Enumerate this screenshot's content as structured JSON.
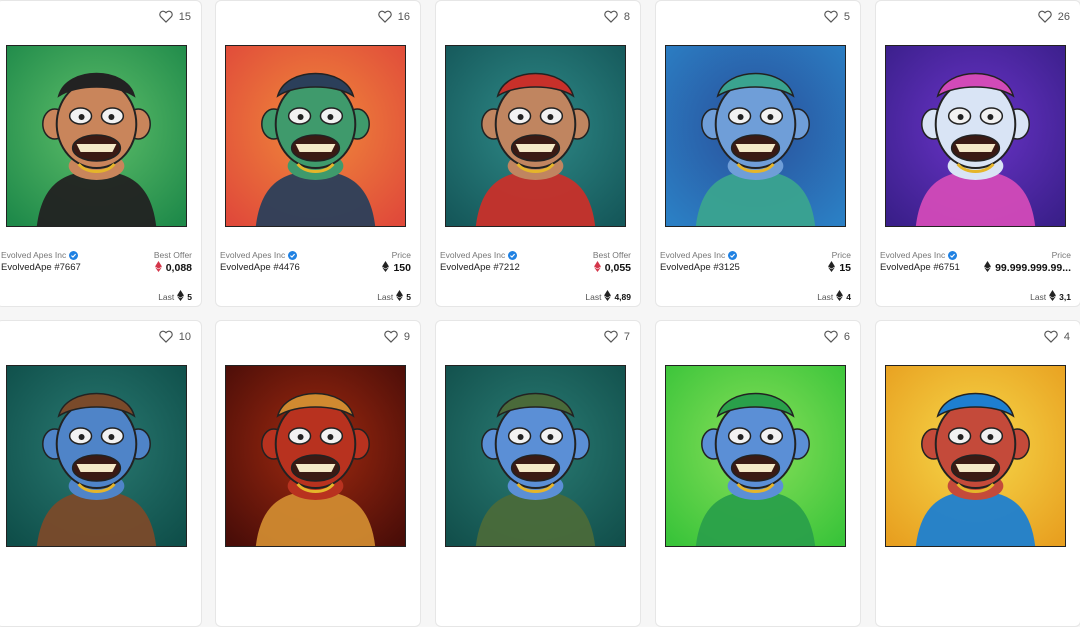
{
  "colors": {
    "verified": "#2081e2",
    "eth_offer": "#d4364a",
    "eth_price": "#222222"
  },
  "icons": {
    "like": "heart-outline-icon",
    "verified": "verified-check-icon",
    "currency": "ethereum-icon"
  },
  "cards": [
    {
      "likes": "15",
      "collection": "Evolved Apes Inc",
      "token": "EvolvedApe #7667",
      "price_label": "Best Offer",
      "price": "0,088",
      "price_currency": "weth",
      "last_label": "Last",
      "last_price": "5",
      "bg": [
        "#1f8a4a",
        "#5fbf6a"
      ],
      "skin": "#c9855b",
      "accent": "#222222"
    },
    {
      "likes": "16",
      "collection": "Evolved Apes Inc",
      "token": "EvolvedApe #4476",
      "price_label": "Price",
      "price": "150",
      "price_currency": "eth",
      "last_label": "Last",
      "last_price": "5",
      "bg": [
        "#e04a3a",
        "#f08a3a"
      ],
      "skin": "#3f9a6c",
      "accent": "#2b3f5a"
    },
    {
      "likes": "8",
      "collection": "Evolved Apes Inc",
      "token": "EvolvedApe #7212",
      "price_label": "Best Offer",
      "price": "0,055",
      "price_currency": "weth",
      "last_label": "Last",
      "last_price": "4,89",
      "bg": [
        "#15585a",
        "#2f8a88"
      ],
      "skin": "#c08560",
      "accent": "#c8302a"
    },
    {
      "likes": "5",
      "collection": "Evolved Apes Inc",
      "token": "EvolvedApe #3125",
      "price_label": "Price",
      "price": "15",
      "price_currency": "eth",
      "last_label": "Last",
      "last_price": "4",
      "bg": [
        "#2b7fc4",
        "#2a4f9a"
      ],
      "skin": "#6f9ed8",
      "accent": "#3aa38f"
    },
    {
      "likes": "26",
      "collection": "Evolved Apes Inc",
      "token": "EvolvedApe #6751",
      "price_label": "Price",
      "price": "99.999.999.99...",
      "price_currency": "eth",
      "last_label": "Last",
      "last_price": "3,1",
      "bg": [
        "#3a1f8a",
        "#6a34c8"
      ],
      "skin": "#d9e4f5",
      "accent": "#d24ab8"
    },
    {
      "likes": "10",
      "collection": "",
      "token": "",
      "price_label": "",
      "price": "",
      "price_currency": "",
      "last_label": "",
      "last_price": "",
      "bg": [
        "#0f4f4a",
        "#2a7a72"
      ],
      "skin": "#4f84c8",
      "accent": "#7a4a2a"
    },
    {
      "likes": "9",
      "collection": "",
      "token": "",
      "price_label": "",
      "price": "",
      "price_currency": "",
      "last_label": "",
      "last_price": "",
      "bg": [
        "#4a0d08",
        "#a02a10"
      ],
      "skin": "#b8321f",
      "accent": "#d08a30"
    },
    {
      "likes": "7",
      "collection": "",
      "token": "",
      "price_label": "",
      "price": "",
      "price_currency": "",
      "last_label": "",
      "last_price": "",
      "bg": [
        "#12504c",
        "#2a7c74"
      ],
      "skin": "#5b8fd6",
      "accent": "#4a6a3a"
    },
    {
      "likes": "6",
      "collection": "",
      "token": "",
      "price_label": "",
      "price": "",
      "price_currency": "",
      "last_label": "",
      "last_price": "",
      "bg": [
        "#3ac43a",
        "#8ae05a"
      ],
      "skin": "#5b8fd6",
      "accent": "#2aa04a"
    },
    {
      "likes": "4",
      "collection": "",
      "token": "",
      "price_label": "",
      "price": "",
      "price_currency": "",
      "last_label": "",
      "last_price": "",
      "bg": [
        "#e8a020",
        "#f6d84a"
      ],
      "skin": "#c44a3a",
      "accent": "#1e7fd0"
    }
  ]
}
